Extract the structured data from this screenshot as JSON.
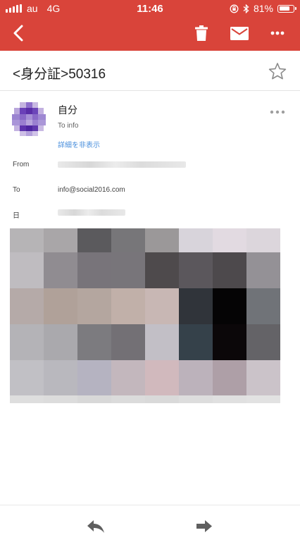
{
  "status_bar": {
    "carrier": "au",
    "network": "4G",
    "time": "11:46",
    "battery": "81%",
    "battery_level": 0.81,
    "icons": [
      "signal-icon",
      "orientation-lock-icon",
      "bluetooth-icon",
      "battery-icon"
    ]
  },
  "toolbar": {
    "icons": [
      "back-arrow-icon",
      "trash-icon",
      "mail-icon",
      "more-vert-icon"
    ],
    "color": "#d9443a"
  },
  "email": {
    "subject": "<身分証>50316",
    "sender_name": "自分",
    "to_short": "To info",
    "hide_details": "詳細を非表示",
    "headers": {
      "from_label": "From",
      "to_label": "To",
      "to_value": "info@social2016.com",
      "date_label": "日"
    }
  },
  "bottom_bar": {
    "icons": [
      "reply-icon",
      "forward-icon"
    ]
  },
  "colors": {
    "accent": "#d9443a",
    "link": "#4a8fdc"
  }
}
